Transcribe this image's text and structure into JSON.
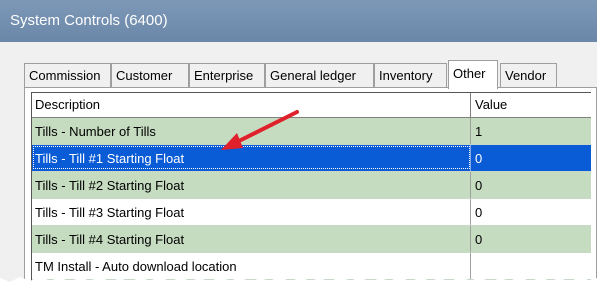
{
  "window": {
    "title": "System Controls (6400)"
  },
  "tabs": [
    {
      "label": "Commission"
    },
    {
      "label": "Customer"
    },
    {
      "label": "Enterprise"
    },
    {
      "label": "General ledger"
    },
    {
      "label": "Inventory"
    },
    {
      "label": "Other"
    },
    {
      "label": "Vendor"
    }
  ],
  "active_tab": "Other",
  "grid": {
    "columns": [
      "Description",
      "Value"
    ],
    "rows": [
      {
        "description": "Tills - Number of Tills",
        "value": "1"
      },
      {
        "description": "Tills - Till #1 Starting Float",
        "value": "0"
      },
      {
        "description": "Tills - Till #2 Starting Float",
        "value": "0"
      },
      {
        "description": "Tills - Till #3 Starting Float",
        "value": "0"
      },
      {
        "description": "Tills - Till #4 Starting Float",
        "value": "0"
      },
      {
        "description": "TM Install - Auto download location",
        "value": ""
      }
    ],
    "selected_row": "Tills - Till #1 Starting Float"
  },
  "colors": {
    "titlebar": "#7d98b7",
    "row_green": "#c6dcc1",
    "selection": "#0a5bd6",
    "arrow": "#e0202a"
  },
  "icons": {
    "annotation": "red-arrow-icon"
  }
}
